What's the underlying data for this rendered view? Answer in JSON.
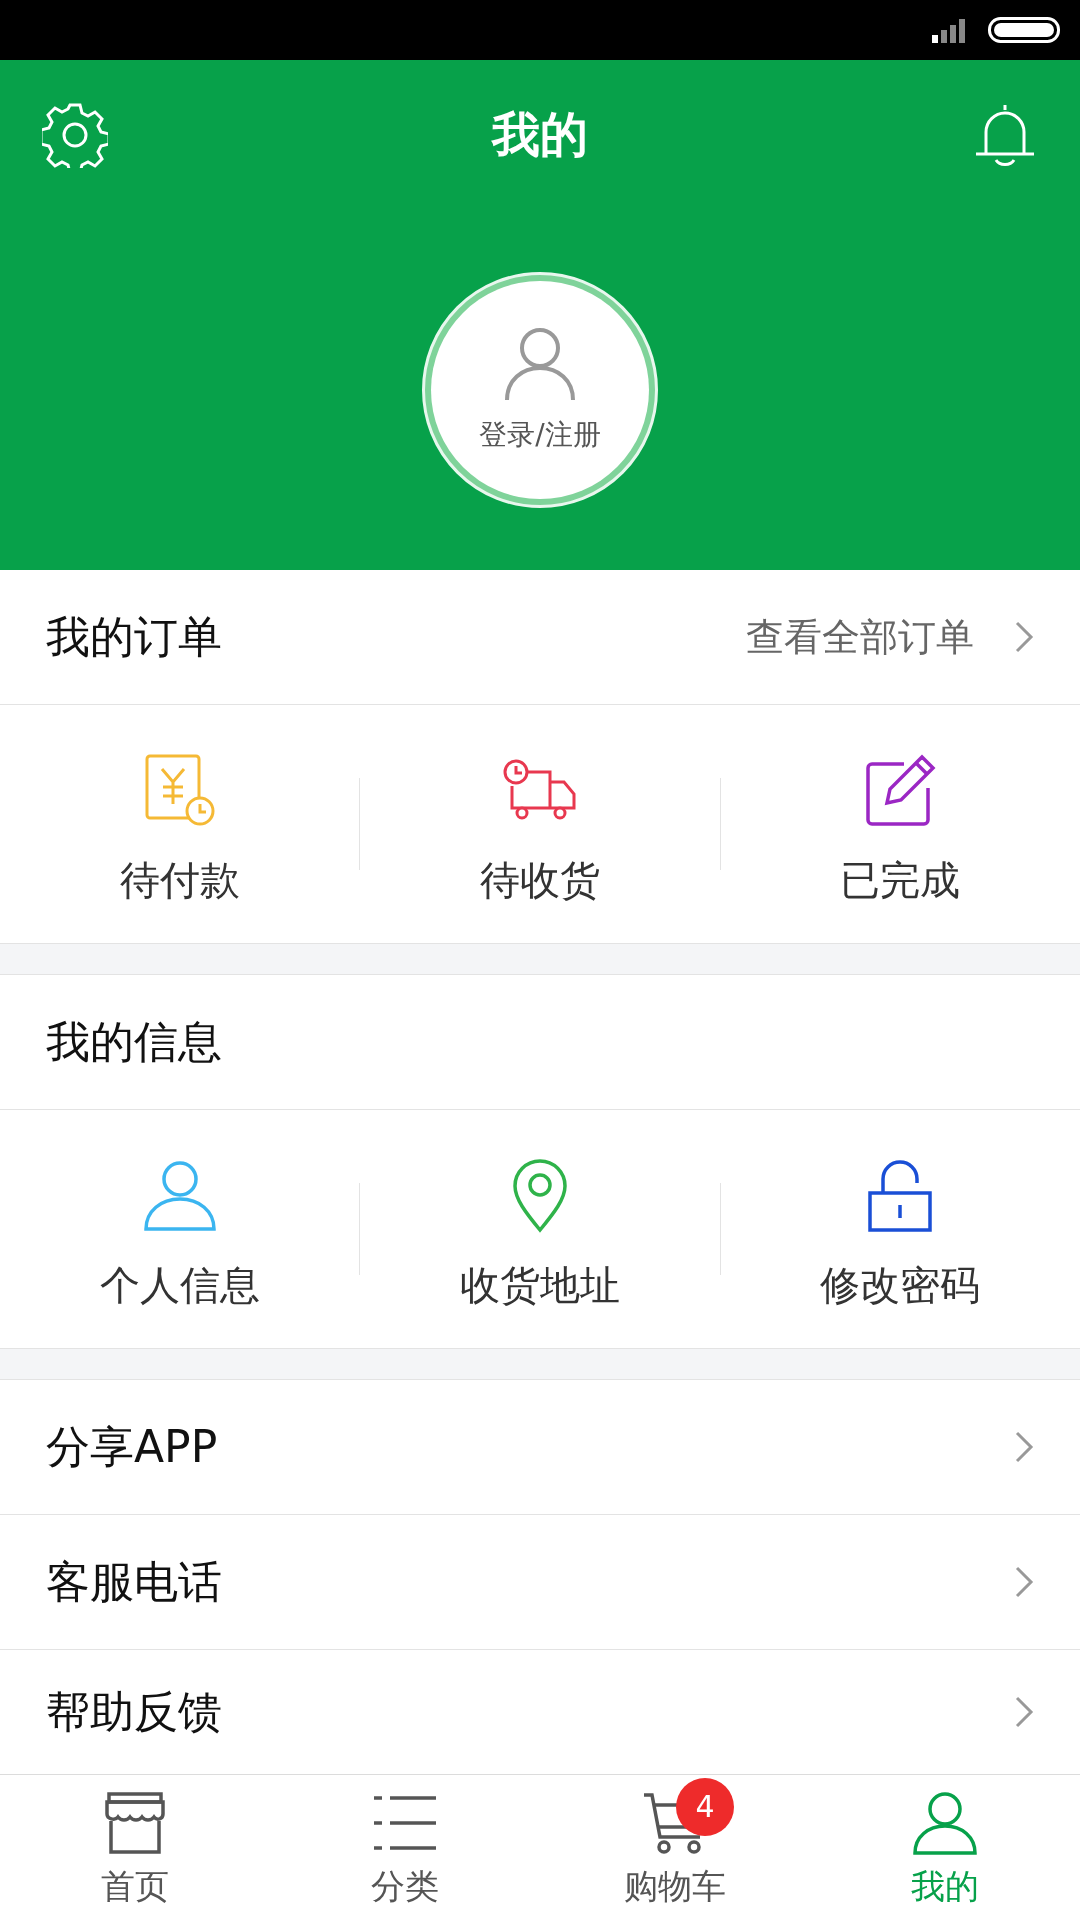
{
  "header": {
    "title": "我的",
    "avatar_label": "登录/注册"
  },
  "orders": {
    "title": "我的订单",
    "link": "查看全部订单",
    "items": [
      {
        "label": "待付款",
        "kind": "payment"
      },
      {
        "label": "待收货",
        "kind": "delivery"
      },
      {
        "label": "已完成",
        "kind": "done"
      }
    ]
  },
  "info": {
    "title": "我的信息",
    "items": [
      {
        "label": "个人信息",
        "kind": "person"
      },
      {
        "label": "收货地址",
        "kind": "location"
      },
      {
        "label": "修改密码",
        "kind": "lock"
      }
    ]
  },
  "menu": [
    {
      "label": "分享APP"
    },
    {
      "label": "客服电话"
    },
    {
      "label": "帮助反馈"
    }
  ],
  "tabs": [
    {
      "label": "首页",
      "kind": "store",
      "selected": false
    },
    {
      "label": "分类",
      "kind": "list",
      "selected": false
    },
    {
      "label": "购物车",
      "kind": "cart",
      "selected": false,
      "badge": "4"
    },
    {
      "label": "我的",
      "kind": "person",
      "selected": true
    }
  ]
}
